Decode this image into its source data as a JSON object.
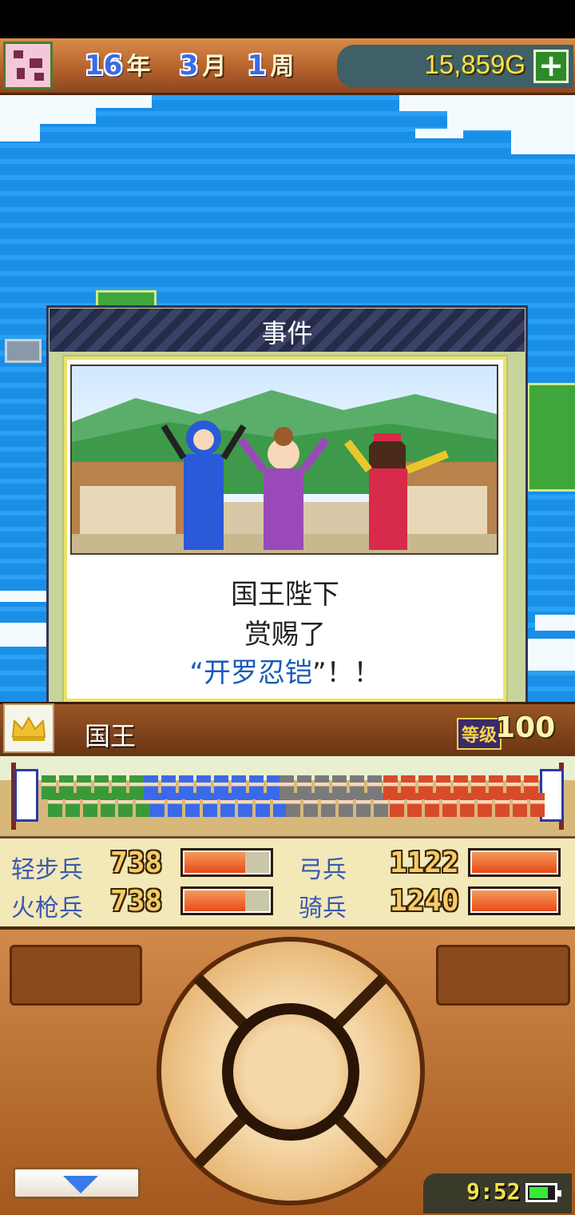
{
  "header": {
    "year": "16",
    "year_unit": "年",
    "month": "3",
    "month_unit": "月",
    "week": "1",
    "week_unit": "周",
    "gold": "15,859G",
    "add_gold_label": "+"
  },
  "event_dialog": {
    "title": "事件",
    "line1": "国王陛下",
    "line2": "赏赐了",
    "item_open_quote": "“",
    "item_name": "开罗忍铠",
    "item_close": "”！！"
  },
  "king": {
    "name": "国王",
    "level_label": "等级",
    "level": "100"
  },
  "troops": [
    {
      "label": "轻步兵",
      "value": "738",
      "fill": 0.72
    },
    {
      "label": "弓兵",
      "value": "1122",
      "fill": 1.0
    },
    {
      "label": "火枪兵",
      "value": "738",
      "fill": 0.72
    },
    {
      "label": "骑兵",
      "value": "1240",
      "fill": 1.0
    }
  ],
  "clock": "9:52",
  "battery_level": 0.75,
  "colors": {
    "sea": "#1a8fe8",
    "gold_text": "#f5e24a",
    "item_name": "#1a5ab8",
    "bar_fill": "#e84a1a"
  }
}
